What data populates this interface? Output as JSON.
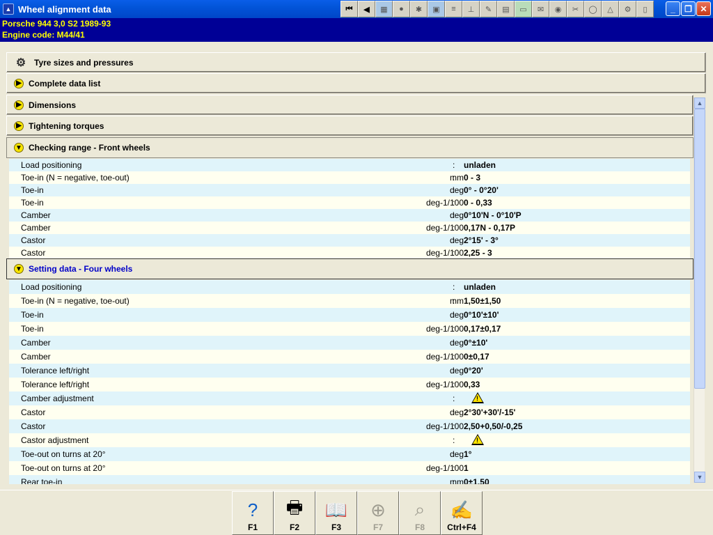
{
  "window": {
    "title": "Wheel alignment data",
    "app_icon": "car-icon"
  },
  "toolbar": [
    {
      "name": "first-icon",
      "glyph": "⏮"
    },
    {
      "name": "back-icon",
      "glyph": "◀"
    },
    {
      "name": "alignment-icon",
      "glyph": "▦"
    },
    {
      "name": "wheel-icon",
      "glyph": "●"
    },
    {
      "name": "parts-icon",
      "glyph": "✱"
    },
    {
      "name": "diagram-icon",
      "glyph": "▣"
    },
    {
      "name": "tools-icon",
      "glyph": "≡"
    },
    {
      "name": "lift-icon",
      "glyph": "⊥"
    },
    {
      "name": "tool-icon",
      "glyph": "✎"
    },
    {
      "name": "calculator-icon",
      "glyph": "▤"
    },
    {
      "name": "green-icon",
      "glyph": "▭"
    },
    {
      "name": "notes-icon",
      "glyph": "✉"
    },
    {
      "name": "oil-icon",
      "glyph": "◉"
    },
    {
      "name": "wrench-icon",
      "glyph": "✂"
    },
    {
      "name": "globe-icon",
      "glyph": "◯"
    },
    {
      "name": "warning-icon",
      "glyph": "△"
    },
    {
      "name": "service-icon",
      "glyph": "⚙"
    },
    {
      "name": "document-icon",
      "glyph": "▯"
    }
  ],
  "vehicle": {
    "line1": "Porsche   944  3,0 S2 1989-93",
    "line2": "Engine code: M44/41"
  },
  "sections": {
    "tyres": "Tyre sizes and pressures",
    "complete": "Complete data list",
    "dimensions": "Dimensions",
    "torques": "Tightening torques",
    "front": "Checking range - Front wheels",
    "setting": "Setting data - Four wheels"
  },
  "front_rows": [
    {
      "label": "Load positioning",
      "unit": "",
      "value": "unladen"
    },
    {
      "label": "Toe-in (N = negative, toe-out)",
      "unit": "mm",
      "value": "0 - 3"
    },
    {
      "label": "Toe-in",
      "unit": "deg",
      "value": "0° - 0°20'"
    },
    {
      "label": "Toe-in",
      "unit": "deg-1/100",
      "value": "0 - 0,33"
    },
    {
      "label": "Camber",
      "unit": "deg",
      "value": "0°10'N - 0°10'P"
    },
    {
      "label": "Camber",
      "unit": "deg-1/100",
      "value": "0,17N - 0,17P"
    },
    {
      "label": "Castor",
      "unit": "deg",
      "value": "2°15' - 3°"
    },
    {
      "label": "Castor",
      "unit": "deg-1/100",
      "value": "2,25 - 3"
    }
  ],
  "setting_rows": [
    {
      "label": "Load positioning",
      "unit": "",
      "value": "unladen"
    },
    {
      "label": "Toe-in (N = negative, toe-out)",
      "unit": "mm",
      "value": "1,50±1,50"
    },
    {
      "label": "Toe-in",
      "unit": "deg",
      "value": "0°10'±10'"
    },
    {
      "label": "Toe-in",
      "unit": "deg-1/100",
      "value": "0,17±0,17"
    },
    {
      "label": "Camber",
      "unit": "deg",
      "value": "0°±10'"
    },
    {
      "label": "Camber",
      "unit": "deg-1/100",
      "value": "0±0,17"
    },
    {
      "label": "Tolerance left/right",
      "unit": "deg",
      "value": "0°20'"
    },
    {
      "label": "Tolerance left/right",
      "unit": "deg-1/100",
      "value": "0,33"
    },
    {
      "label": "Camber adjustment",
      "unit": "",
      "value": "",
      "warning": true
    },
    {
      "label": "Castor",
      "unit": "deg",
      "value": "2°30'+30'/-15'"
    },
    {
      "label": "Castor",
      "unit": "deg-1/100",
      "value": "2,50+0,50/-0,25"
    },
    {
      "label": "Castor adjustment",
      "unit": "",
      "value": "",
      "warning": true
    },
    {
      "label": "Toe-out on turns at 20°",
      "unit": "deg",
      "value": "1°"
    },
    {
      "label": "Toe-out on turns at 20°",
      "unit": "deg-1/100",
      "value": "1"
    },
    {
      "label": "Rear toe-in",
      "unit": "mm",
      "value": "0±1,50"
    }
  ],
  "fkeys": [
    {
      "label": "F1",
      "icon": "help-icon",
      "glyph": "?",
      "enabled": true
    },
    {
      "label": "F2",
      "icon": "printer-icon",
      "glyph": "🖶",
      "enabled": true
    },
    {
      "label": "F3",
      "icon": "book-icon",
      "glyph": "📖",
      "enabled": true
    },
    {
      "label": "F7",
      "icon": "target-icon",
      "glyph": "⊕",
      "enabled": false
    },
    {
      "label": "F8",
      "icon": "search-text-icon",
      "glyph": "⌕",
      "enabled": false
    },
    {
      "label": "Ctrl+F4",
      "icon": "notepad-icon",
      "glyph": "✍",
      "enabled": true
    }
  ]
}
